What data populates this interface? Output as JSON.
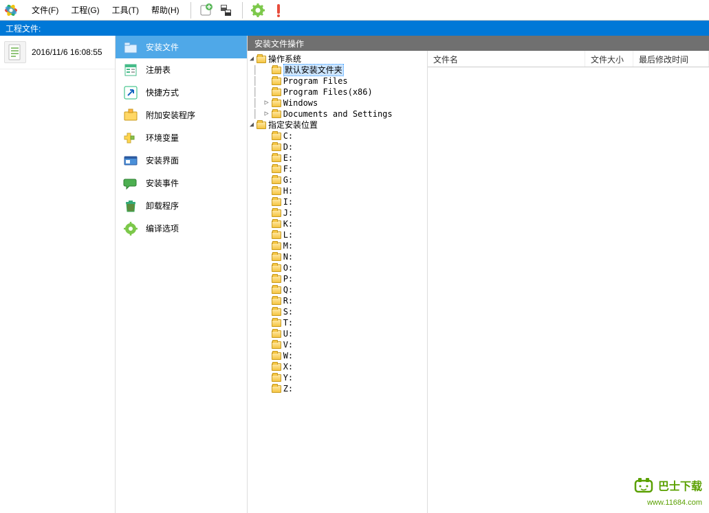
{
  "menubar": {
    "items": [
      "文件(F)",
      "工程(G)",
      "工具(T)",
      "帮助(H)"
    ]
  },
  "toolbar": {
    "buttons": [
      "new-project",
      "save",
      "build",
      "about"
    ]
  },
  "header": {
    "title": "工程文件:"
  },
  "project": {
    "date": "2016/11/6 16:08:55"
  },
  "nav": {
    "items": [
      {
        "label": "安装文件",
        "icon": "install-files",
        "selected": true
      },
      {
        "label": "注册表",
        "icon": "registry"
      },
      {
        "label": "快捷方式",
        "icon": "shortcut"
      },
      {
        "label": "附加安装程序",
        "icon": "addon"
      },
      {
        "label": "环境变量",
        "icon": "env"
      },
      {
        "label": "安装界面",
        "icon": "ui"
      },
      {
        "label": "安装事件",
        "icon": "events"
      },
      {
        "label": "卸载程序",
        "icon": "uninstall"
      },
      {
        "label": "编译选项",
        "icon": "compile"
      }
    ]
  },
  "panel": {
    "title": "安装文件操作"
  },
  "tree": {
    "root1": {
      "label": "操作系统"
    },
    "root1_children": [
      {
        "label": "默认安装文件夹",
        "selected": true
      },
      {
        "label": "Program Files"
      },
      {
        "label": "Program Files(x86)"
      },
      {
        "label": "Windows",
        "expandable": true
      },
      {
        "label": "Documents and Settings",
        "expandable": true
      }
    ],
    "root2": {
      "label": "指定安装位置"
    },
    "drives": [
      "C:",
      "D:",
      "E:",
      "F:",
      "G:",
      "H:",
      "I:",
      "J:",
      "K:",
      "L:",
      "M:",
      "N:",
      "O:",
      "P:",
      "Q:",
      "R:",
      "S:",
      "T:",
      "U:",
      "V:",
      "W:",
      "X:",
      "Y:",
      "Z:"
    ]
  },
  "list": {
    "columns": [
      "文件名",
      "文件大小",
      "最后修改时间"
    ]
  },
  "watermark": {
    "brand": "巴士下载",
    "url": "www.11684.com"
  }
}
